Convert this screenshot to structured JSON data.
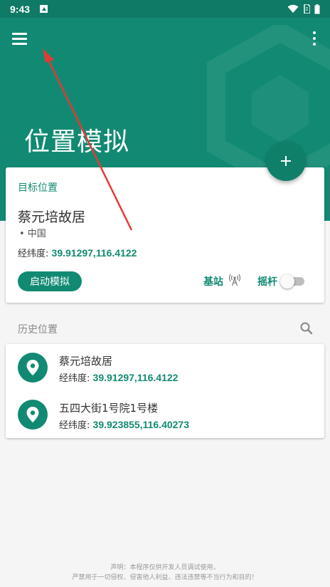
{
  "status_bar": {
    "time": "9:43"
  },
  "header": {
    "title": "位置模拟"
  },
  "target": {
    "section_label": "目标位置",
    "place_name": "蔡元培故居",
    "country": "• 中国",
    "coord_label": "经纬度:",
    "coord_value": "39.91297,116.4122",
    "start_button": "启动模拟",
    "base_station_label": "基站",
    "joystick_label": "摇杆",
    "joystick_enabled": false
  },
  "history": {
    "title": "历史位置",
    "items": [
      {
        "name": "蔡元培故居",
        "coord_label": "经纬度:",
        "coord_value": "39.91297,116.4122"
      },
      {
        "name": "五四大街1号院1号楼",
        "coord_label": "经纬度:",
        "coord_value": "39.923855,116.40273"
      }
    ]
  },
  "footer": {
    "line1": "声明：本程序仅供开发人员调试使用，",
    "line2": "严禁用于一切侵权、侵害他人利益、违法违禁等不当行为和目的！"
  },
  "colors": {
    "primary": "#128a73",
    "status_bar": "#0f7a66",
    "annotation_arrow": "#e53935"
  },
  "icons": [
    "menu-icon",
    "more-vert-icon",
    "add-icon",
    "cell-tower-icon",
    "search-icon",
    "location-pin-icon",
    "wifi-icon",
    "battery-icon"
  ]
}
